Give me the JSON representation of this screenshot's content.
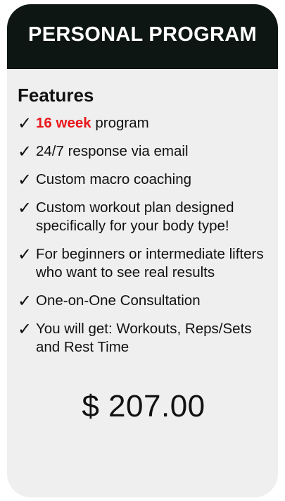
{
  "card": {
    "title": "PERSONAL PROGRAM",
    "features_heading": "Features",
    "check_glyph": "✓",
    "features": [
      {
        "highlight": "16 week",
        "text": " program"
      },
      {
        "highlight": "",
        "text": "24/7 response via email"
      },
      {
        "highlight": "",
        "text": "Custom macro coaching"
      },
      {
        "highlight": "",
        "text": "Custom workout plan designed specifically for your body type!"
      },
      {
        "highlight": "",
        "text": "For beginners or intermediate lifters who want to see real results"
      },
      {
        "highlight": "",
        "text": "One-on-One Consultation"
      },
      {
        "highlight": "",
        "text": "You will get: Workouts, Reps/Sets and Rest Time"
      }
    ],
    "price": "$ 207.00"
  },
  "colors": {
    "header_bg": "#0d1612",
    "card_bg": "#efefef",
    "highlight": "#e8171a"
  },
  "icons": {
    "check": "check-icon"
  }
}
